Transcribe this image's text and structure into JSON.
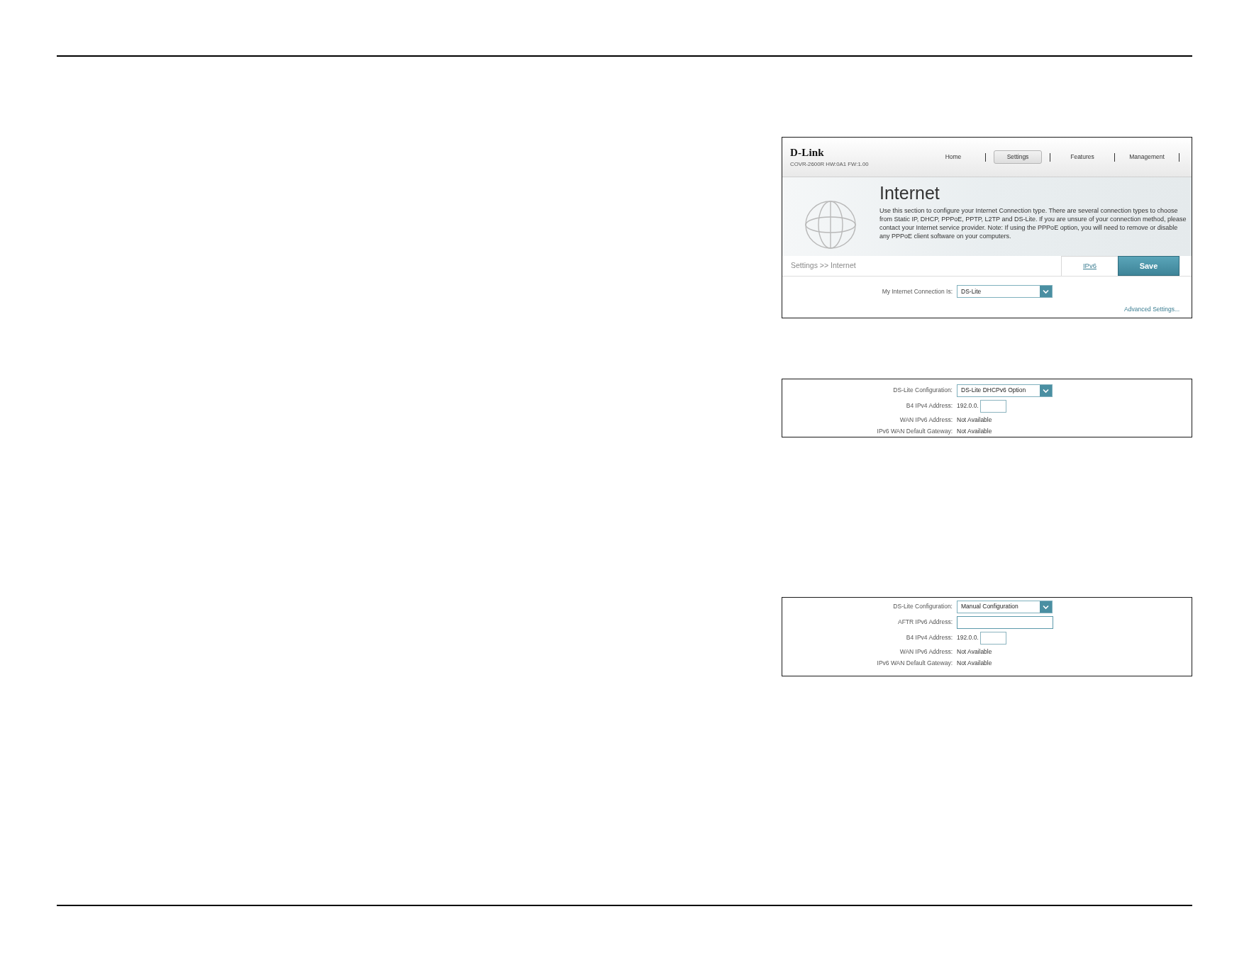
{
  "router_ui": {
    "brand": "D-Link",
    "model": "COVR-2600R HW:0A1 FW:1.00",
    "nav": [
      {
        "label": "Home",
        "selected": false
      },
      {
        "label": "Settings",
        "selected": true
      },
      {
        "label": "Features",
        "selected": false
      },
      {
        "label": "Management",
        "selected": false
      }
    ],
    "title": "Internet",
    "description": "Use this section to configure your Internet Connection type. There are several connection types to choose from Static IP, DHCP, PPPoE, PPTP, L2TP and DS-Lite. If you are unsure of your connection method, please contact your Internet service provider. Note: If using the PPPoE option, you will need to remove or disable any PPPoE client software on your computers.",
    "breadcrumb": "Settings >> Internet",
    "ipv6_link": "IPv6",
    "save_button": "Save",
    "connection": {
      "label": "My Internet Connection Is:",
      "value": "DS-Lite"
    },
    "advanced_link": "Advanced Settings..."
  },
  "config_panels": [
    {
      "rows": [
        {
          "kind": "select",
          "label": "DS-Lite Configuration:",
          "value": "DS-Lite DHCPv6 Option"
        },
        {
          "kind": "prefix_input",
          "label": "B4 IPv4 Address:",
          "prefix": "192.0.0."
        },
        {
          "kind": "text",
          "label": "WAN IPv6 Address:",
          "value": "Not Available"
        },
        {
          "kind": "text",
          "label": "IPv6 WAN Default Gateway:",
          "value": "Not Available"
        }
      ]
    },
    {
      "rows": [
        {
          "kind": "select",
          "label": "DS-Lite Configuration:",
          "value": "Manual Configuration"
        },
        {
          "kind": "input",
          "label": "AFTR IPv6 Address:"
        },
        {
          "kind": "prefix_input",
          "label": "B4 IPv4 Address:",
          "prefix": "192.0.0."
        },
        {
          "kind": "text",
          "label": "WAN IPv6 Address:",
          "value": "Not Available"
        },
        {
          "kind": "text",
          "label": "IPv6 WAN Default Gateway:",
          "value": "Not Available"
        }
      ]
    }
  ]
}
